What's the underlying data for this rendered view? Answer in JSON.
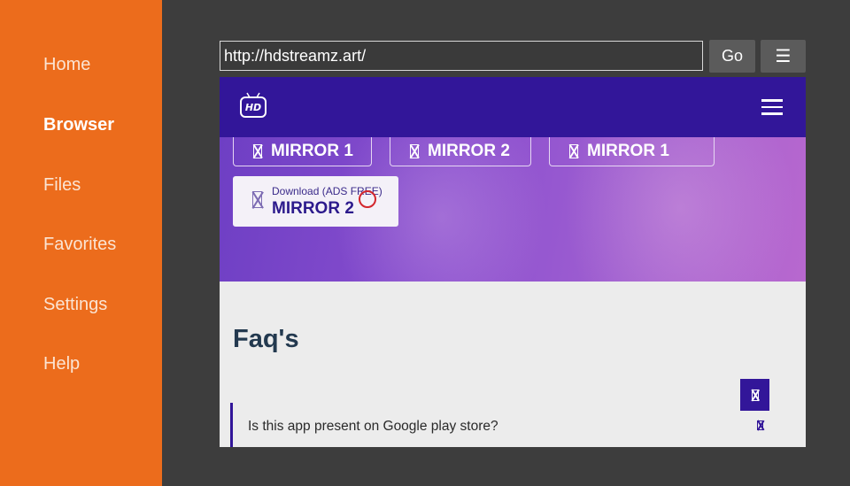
{
  "sidebar": {
    "items": [
      {
        "label": "Home",
        "active": false
      },
      {
        "label": "Browser",
        "active": true
      },
      {
        "label": "Files",
        "active": false
      },
      {
        "label": "Favorites",
        "active": false
      },
      {
        "label": "Settings",
        "active": false
      },
      {
        "label": "Help",
        "active": false
      }
    ]
  },
  "browser": {
    "url": "http://hdstreamz.art/",
    "go_label": "Go",
    "menu_icon": "☰"
  },
  "site": {
    "logo_text": "HD",
    "logo_icon": "tv-logo-icon",
    "menu_icon": "hamburger-icon",
    "mirror_buttons": [
      {
        "label": "MIRROR 1"
      },
      {
        "label": "MIRROR 2"
      },
      {
        "label": "MIRROR 1"
      }
    ],
    "download": {
      "small_label": "Download (ADS FREE)",
      "big_label": "MIRROR 2"
    },
    "faq_heading": "Faq's",
    "faq_items": [
      {
        "question": "Is this app present on Google play store?"
      }
    ]
  },
  "colors": {
    "sidebar_bg": "#ec6c1c",
    "site_header_bg": "#321699",
    "hero_gradient": "#8a4fcf",
    "cursor_ring": "#d3262d"
  }
}
